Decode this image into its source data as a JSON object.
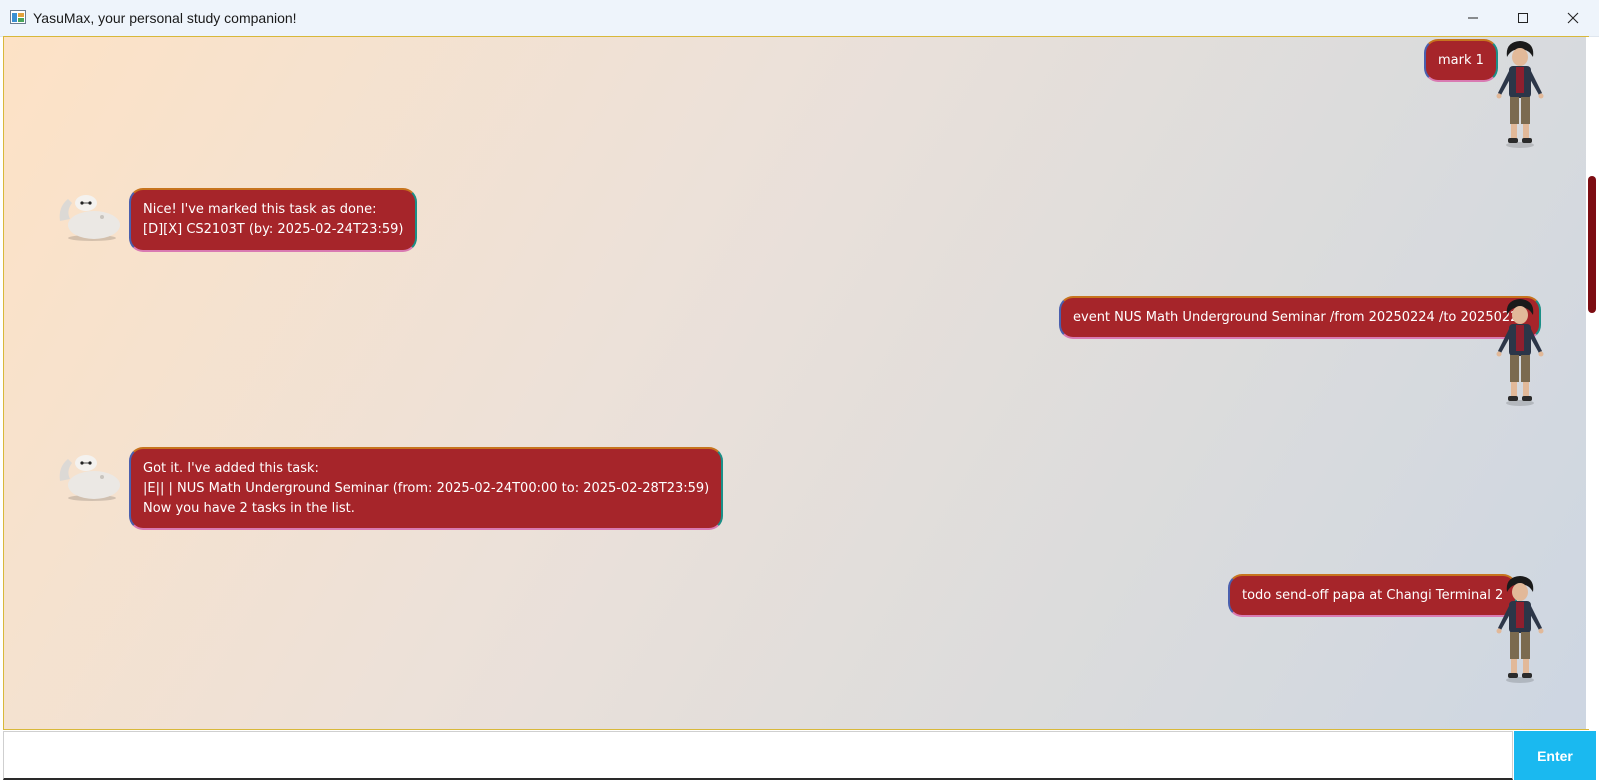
{
  "window": {
    "title": "YasuMax, your personal study companion!",
    "icon": "java-app-icon"
  },
  "titlebar_controls": {
    "minimize": "minimize-icon",
    "maximize": "maximize-icon",
    "close": "close-icon"
  },
  "messages": [
    {
      "sender": "user",
      "avatar": "hiro-avatar",
      "lines": [
        "mark 1"
      ]
    },
    {
      "sender": "bot",
      "avatar": "baymax-avatar",
      "lines": [
        "Nice! I've marked this task as done:",
        "[D][X] CS2103T (by: 2025-02-24T23:59)"
      ]
    },
    {
      "sender": "user",
      "avatar": "hiro-avatar",
      "lines": [
        "event NUS Math Underground Seminar /from 20250224 /to 20250228"
      ]
    },
    {
      "sender": "bot",
      "avatar": "baymax-avatar",
      "lines": [
        "Got it. I've added this task:",
        "|E|| | NUS Math Underground Seminar (from: 2025-02-24T00:00 to: 2025-02-28T23:59)",
        "Now you have 2 tasks in the list."
      ]
    },
    {
      "sender": "user",
      "avatar": "hiro-avatar",
      "lines": [
        "todo send-off papa at Changi Terminal 2"
      ]
    }
  ],
  "input": {
    "value": "",
    "placeholder": ""
  },
  "send_button": {
    "label": "Enter"
  },
  "colors": {
    "bubble": "#a6252a",
    "send_button": "#1ab9f0",
    "scroll_thumb": "#7d0d13"
  }
}
